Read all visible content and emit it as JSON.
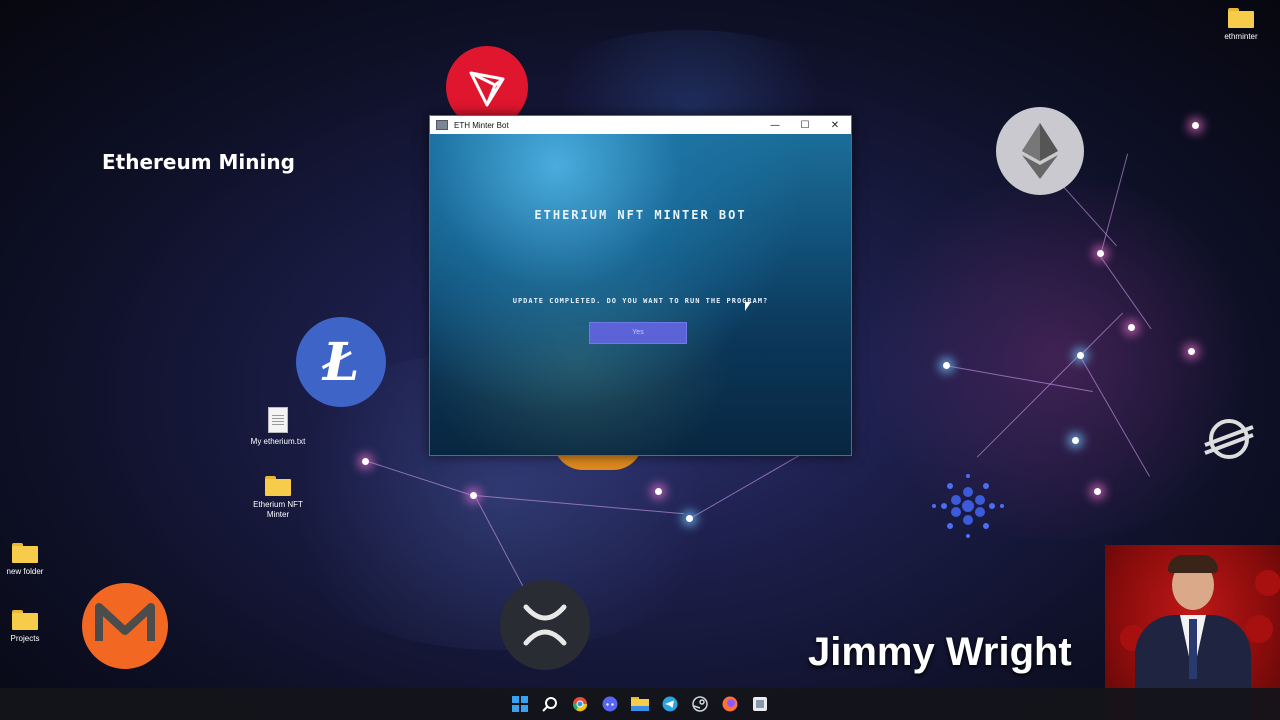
{
  "desktop": {
    "overlay_title": "Ethereum Mining",
    "icons": [
      {
        "label": "ethminter",
        "type": "folder"
      },
      {
        "label": "My etherium.txt",
        "type": "file"
      },
      {
        "label": "Etherium NFT Minter",
        "type": "folder"
      },
      {
        "label": "new folder",
        "type": "folder"
      },
      {
        "label": "Projects",
        "type": "folder"
      }
    ]
  },
  "window": {
    "title": "ETH Minter Bot",
    "minimize_symbol": "—",
    "maximize_symbol": "☐",
    "close_symbol": "✕",
    "heading": "ETHERIUM NFT MINTER BOT",
    "message": "UPDATE COMPLETED. DO YOU WANT TO RUN THE PROGRAM?",
    "yes_label": "Yes"
  },
  "presenter": {
    "name": "Jimmy Wright"
  },
  "taskbar": {
    "icons": [
      "windows-start-icon",
      "search-icon",
      "chrome-icon",
      "discord-icon",
      "file-explorer-icon",
      "telegram-icon",
      "steam-icon",
      "firefox-icon",
      "app-icon"
    ]
  },
  "colors": {
    "accent_button": "#5b63d6",
    "presenter_bg": "#c01818",
    "folder": "#f6cc4a"
  }
}
